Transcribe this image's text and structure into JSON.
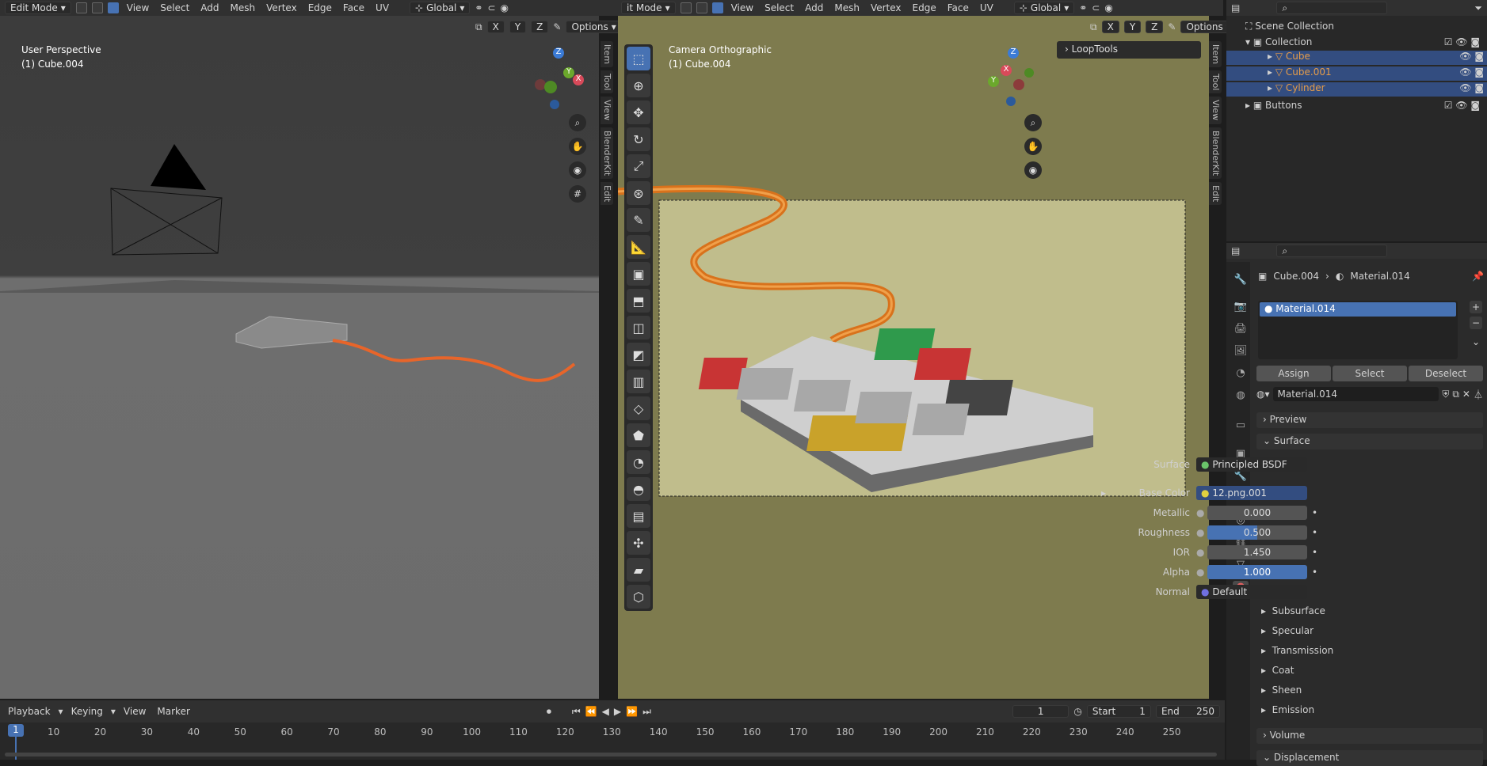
{
  "left_viewport": {
    "mode": "Edit Mode",
    "menus": [
      "View",
      "Select",
      "Add",
      "Mesh",
      "Vertex",
      "Edge",
      "Face",
      "UV"
    ],
    "orientation": "Global",
    "axes": [
      "X",
      "Y",
      "Z"
    ],
    "options": "Options",
    "title": "User Perspective",
    "object": "(1) Cube.004",
    "gizmo": {
      "z": "Z",
      "y": "Y",
      "x": "X"
    },
    "tabs": [
      "Item",
      "Tool",
      "View",
      "BlenderKit",
      "Edit"
    ]
  },
  "right_viewport": {
    "mode": "it Mode",
    "menus": [
      "View",
      "Select",
      "Add",
      "Mesh",
      "Vertex",
      "Edge",
      "Face",
      "UV"
    ],
    "orientation": "Global",
    "axes": [
      "X",
      "Y",
      "Z"
    ],
    "options": "Options",
    "title": "Camera Orthographic",
    "object": "(1) Cube.004",
    "looptools": "LoopTools",
    "gizmo": {
      "z": "Z",
      "y": "Y",
      "x": "X"
    },
    "tabs": [
      "Item",
      "Tool",
      "View",
      "BlenderKit",
      "Edit"
    ]
  },
  "outliner": {
    "items": [
      {
        "label": "Scene Collection",
        "indent": 0
      },
      {
        "label": "Collection",
        "indent": 1
      },
      {
        "label": "Cube",
        "indent": 2
      },
      {
        "label": "Cube.001",
        "indent": 2
      },
      {
        "label": "Cylinder",
        "indent": 2
      },
      {
        "label": "Buttons",
        "indent": 1
      }
    ]
  },
  "properties": {
    "breadcrumb_object": "Cube.004",
    "breadcrumb_material": "Material.014",
    "slot": "Material.014",
    "assign": "Assign",
    "select": "Select",
    "deselect": "Deselect",
    "material_name": "Material.014",
    "preview": "Preview",
    "surface_header": "Surface",
    "rows": [
      {
        "label": "Surface",
        "value": "Principled BSDF",
        "kind": "node"
      },
      {
        "label": "Base Color",
        "value": "12.png.001",
        "kind": "node"
      },
      {
        "label": "Metallic",
        "value": "0.000",
        "kind": "num",
        "fill": 0
      },
      {
        "label": "Roughness",
        "value": "0.500",
        "kind": "num",
        "fill": 0.5
      },
      {
        "label": "IOR",
        "value": "1.450",
        "kind": "num",
        "fill": 0
      },
      {
        "label": "Alpha",
        "value": "1.000",
        "kind": "num",
        "fill": 1
      },
      {
        "label": "Normal",
        "value": "Default",
        "kind": "node"
      }
    ],
    "subpanels": [
      "Subsurface",
      "Specular",
      "Transmission",
      "Coat",
      "Sheen",
      "Emission"
    ],
    "volume": "Volume",
    "displacement": "Displacement"
  },
  "timeline": {
    "menus": [
      "Playback",
      "Keying",
      "View",
      "Marker"
    ],
    "current_frame": "1",
    "start_label": "Start",
    "start": "1",
    "end_label": "End",
    "end": "250",
    "ticks": [
      "1",
      "10",
      "20",
      "30",
      "40",
      "50",
      "60",
      "70",
      "80",
      "90",
      "100",
      "110",
      "120",
      "130",
      "140",
      "150",
      "160",
      "170",
      "180",
      "190",
      "200",
      "210",
      "220",
      "230",
      "240",
      "250"
    ]
  }
}
